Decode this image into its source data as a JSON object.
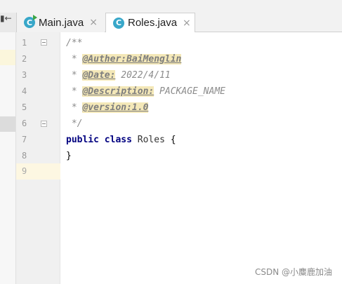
{
  "tabs": [
    {
      "label": "Main.java",
      "icon": "c-class-run-icon",
      "close": "×"
    },
    {
      "label": "Roles.java",
      "icon": "c-class-icon",
      "close": "×"
    }
  ],
  "left_arrow": "▮←",
  "gutter": {
    "line_numbers": [
      "1",
      "2",
      "3",
      "4",
      "5",
      "6",
      "7",
      "8",
      "9"
    ]
  },
  "code": {
    "l1": "/**",
    "l2_star": " * ",
    "l2_tag": "@Auther:BaiMenglin",
    "l3_star": " * ",
    "l3_tag": "@Date:",
    "l3_val": " 2022/4/11",
    "l4_star": " * ",
    "l4_tag": "@Description:",
    "l4_val": " PACKAGE_NAME",
    "l5_star": " * ",
    "l5_tag": "@version:1.0",
    "l6": " */",
    "l7_kw1": "public",
    "l7_kw2": "class",
    "l7_name": "Roles",
    "l7_brace": "{",
    "l8": "}"
  },
  "watermark": "CSDN @小麋鹿加油",
  "colors": {
    "caret_line": "#fdf7e2",
    "keyword": "#000080",
    "tag_highlight": "#f4e8b8"
  }
}
